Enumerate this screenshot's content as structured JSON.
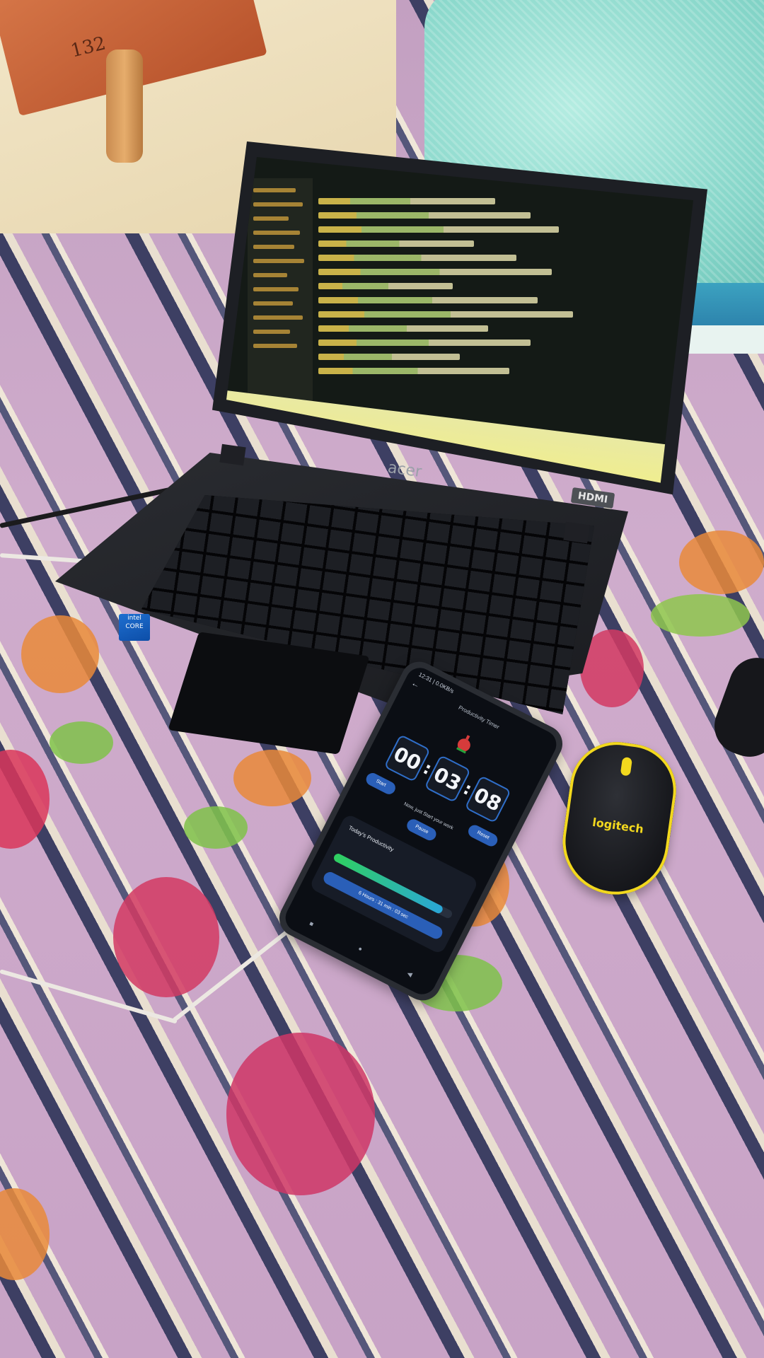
{
  "headboard": {
    "number": "132"
  },
  "laptop": {
    "brand": "acer",
    "port_label": "HDMI",
    "intel_badge": "intel CORE"
  },
  "phone": {
    "status": "12:31 | 0.0KB/s",
    "app_title": "Productivity Timer",
    "timer": {
      "hours": "00",
      "minutes": "03",
      "seconds": "08"
    },
    "buttons": {
      "start": "Start",
      "pause": "Pause",
      "reset": "Reset"
    },
    "hint": "Now, just Start your work",
    "card": {
      "title": "Today's Productivity",
      "progress": 0.92,
      "total": "6 Hours : 31 min : 03 sec"
    }
  },
  "mouse": {
    "brand": "logitech"
  },
  "colors": {
    "accent_blue": "#2a5fb8",
    "mouse_yellow": "#f2d81e",
    "code_yellow": "#f1d354"
  }
}
